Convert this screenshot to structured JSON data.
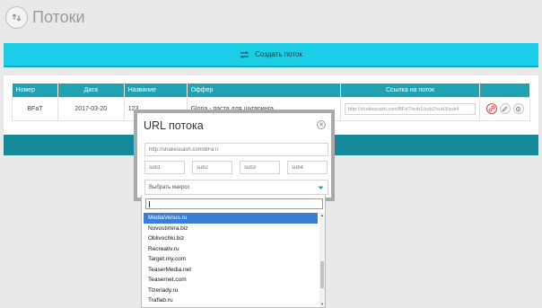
{
  "header": {
    "title": "Потоки",
    "icon": "refresh-icon"
  },
  "create_button": {
    "label": "Создать поток",
    "icon": "swap-icon"
  },
  "table": {
    "columns": [
      "Номер",
      "Дата",
      "Название",
      "Оффер",
      "Ссылка на поток",
      ""
    ],
    "rows": [
      {
        "number": "BFaT",
        "date": "2017-03-20",
        "name": "123",
        "offer": "Gloria - паста для шугаринга",
        "link": "http://shakescash.com/BFaT/sub1/sub2/sub3/sub4"
      }
    ]
  },
  "modal": {
    "title": "URL потока",
    "url_placeholder": "http://shakescash.com/BFaT/",
    "subs": [
      "sub1",
      "sub2",
      "sub3",
      "sub4"
    ],
    "macro_select": "Выбрать макрос"
  },
  "dropdown": {
    "search_value": "",
    "options": [
      "MediaVenus.ru",
      "Novostimira.biz",
      "Oblivochki.biz",
      "Recreativ.ru",
      "Target.my.com",
      "TeaserMedia.net",
      "Teasernet.com",
      "Tizerlady.ru",
      "Traflab.ru"
    ],
    "selected": "MediaVenus.ru"
  },
  "colors": {
    "accent": "#1ccde7",
    "header_teal": "#1fa3b3",
    "dark_teal": "#168a9a",
    "selected": "#3a7fd5"
  }
}
